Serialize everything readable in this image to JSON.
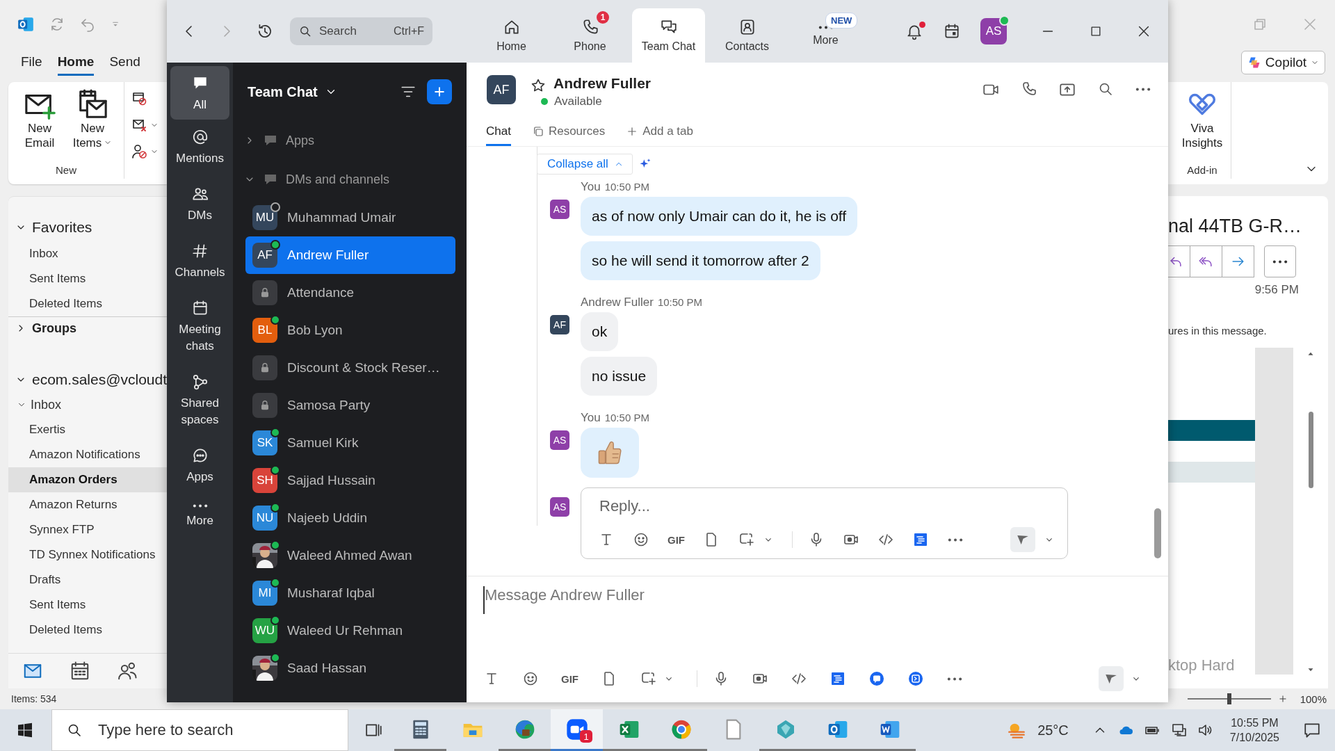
{
  "outlook": {
    "tabs": [
      {
        "label": "File",
        "selected": false
      },
      {
        "label": "Home",
        "selected": true
      },
      {
        "label": "Send",
        "selected": false
      }
    ],
    "ribbon": {
      "new_group": {
        "label": "New",
        "buttons": [
          {
            "label": "New Email",
            "kind": "new_email",
            "dropdown": false
          },
          {
            "label": "New Items",
            "kind": "new_items",
            "dropdown": true
          }
        ]
      },
      "addin_group": {
        "label": "Add-in",
        "buttons": [
          {
            "label": "Viva Insights"
          }
        ]
      },
      "copilot": "Copilot"
    },
    "nav": [
      {
        "label": "Favorites",
        "expanded": true,
        "bold": false,
        "children": [
          {
            "label": "Inbox",
            "selected": false
          },
          {
            "label": "Sent Items",
            "selected": false
          },
          {
            "label": "Deleted Items",
            "selected": false
          }
        ]
      },
      {
        "label": "Groups",
        "expanded": false,
        "bold": true
      },
      {
        "label": "ecom.sales@vcloudt",
        "expanded": true,
        "bold": false,
        "children": [
          {
            "label": "Inbox",
            "selected": false,
            "expanded": true,
            "children": [
              {
                "label": "Exertis",
                "selected": false
              },
              {
                "label": "Amazon Notifications",
                "selected": false
              },
              {
                "label": "Amazon Orders",
                "selected": true
              },
              {
                "label": "Amazon Returns",
                "selected": false
              },
              {
                "label": "Synnex FTP",
                "selected": false
              },
              {
                "label": "TD Synnex Notifications",
                "selected": false
              }
            ]
          },
          {
            "label": "Drafts",
            "selected": false
          },
          {
            "label": "Sent Items",
            "selected": false
          },
          {
            "label": "Deleted Items",
            "selected": false
          }
        ]
      }
    ],
    "status_bar": "Items: 534",
    "reading_pane": {
      "subject": "nal 44TB G-R…",
      "time": "9:56 PM",
      "notice": "ures in this message.",
      "body_text": "ktop Hard"
    },
    "zoom": {
      "level": 0.5,
      "reading": "100%"
    }
  },
  "zoom_app": {
    "search": {
      "placeholder": "Search",
      "shortcut": "Ctrl+F"
    },
    "nav_tabs": [
      {
        "label": "Home",
        "kind": "home",
        "selected": false
      },
      {
        "label": "Phone",
        "kind": "phone",
        "selected": false,
        "badge": "1"
      },
      {
        "label": "Team Chat",
        "kind": "chat",
        "selected": true
      },
      {
        "label": "Contacts",
        "kind": "contacts",
        "selected": false
      },
      {
        "label": "More",
        "kind": "more",
        "selected": false,
        "tag": "NEW"
      }
    ],
    "notifications_unread": true,
    "account": {
      "initials": "AS",
      "online": true
    },
    "rail": [
      {
        "label": "All",
        "kind": "all",
        "selected": true
      },
      {
        "label": "Mentions",
        "kind": "mentions",
        "selected": false
      },
      {
        "label": "DMs",
        "kind": "dms",
        "selected": false
      },
      {
        "label": "Channels",
        "kind": "channels",
        "selected": false
      },
      {
        "label": "Meeting chats",
        "kind": "meetings",
        "selected": false
      },
      {
        "label": "Shared spaces",
        "kind": "shared",
        "selected": false
      },
      {
        "label": "Apps",
        "kind": "apps",
        "selected": false
      },
      {
        "label": "More",
        "kind": "more",
        "selected": false
      }
    ],
    "list": {
      "title": "Team Chat",
      "sections": [
        {
          "label": "Apps",
          "expanded": false
        },
        {
          "label": "DMs and channels",
          "expanded": true,
          "children": [
            {
              "name": "Muhammad Umair",
              "kind": "person",
              "initials": "MU",
              "color": "#34465c",
              "online": false,
              "selected": false
            },
            {
              "name": "Andrew Fuller",
              "kind": "person",
              "initials": "AF",
              "color": "#34465c",
              "online": true,
              "selected": true
            },
            {
              "name": "Attendance",
              "kind": "channel",
              "selected": false
            },
            {
              "name": "Bob Lyon",
              "kind": "person",
              "initials": "BL",
              "color": "#e35e0e",
              "online": true,
              "selected": false
            },
            {
              "name": "Discount & Stock Reser…",
              "kind": "channel",
              "selected": false
            },
            {
              "name": "Samosa Party",
              "kind": "channel",
              "selected": false
            },
            {
              "name": "Samuel Kirk",
              "kind": "person",
              "initials": "SK",
              "color": "#2b88d8",
              "online": true,
              "selected": false
            },
            {
              "name": "Sajjad Hussain",
              "kind": "person",
              "initials": "SH",
              "color": "#d9443a",
              "online": true,
              "selected": false
            },
            {
              "name": "Najeeb Uddin",
              "kind": "person",
              "initials": "NU",
              "color": "#2b88d8",
              "online": true,
              "selected": false
            },
            {
              "name": "Waleed Ahmed Awan",
              "online": true,
              "selected": false
            },
            {
              "name": "Musharaf Iqbal",
              "kind": "person",
              "initials": "MI",
              "color": "#2b88d8",
              "online": true,
              "selected": false
            },
            {
              "name": "Waleed Ur Rehman",
              "kind": "person",
              "initials": "WU",
              "color": "#25a244",
              "online": true,
              "selected": false
            },
            {
              "name": "Saad Hassan",
              "online": true,
              "selected": false
            }
          ]
        }
      ]
    },
    "chat": {
      "contact": {
        "initials": "AF",
        "name": "Andrew Fuller",
        "status": "Available",
        "favorite": false
      },
      "tabs": [
        {
          "label": "Chat",
          "kind": "chat",
          "selected": true
        },
        {
          "label": "Resources",
          "kind": "resources",
          "selected": false
        },
        {
          "label": "Add a tab",
          "kind": "add",
          "selected": false
        }
      ],
      "thread": {
        "collapse_label": "Collapse all",
        "groups": [
          {
            "sender": "You",
            "time": "10:50 PM",
            "avatar": "AS",
            "mine": true,
            "messages": [
              {
                "kind": "text",
                "text": "as of now only Umair can do it, he is off"
              },
              {
                "kind": "text",
                "text": "so he will send it tomorrow after 2"
              }
            ]
          },
          {
            "sender": "Andrew Fuller",
            "time": "10:50 PM",
            "avatar": "AF",
            "mine": false,
            "messages": [
              {
                "kind": "text",
                "text": "ok"
              },
              {
                "kind": "text",
                "text": "no issue"
              }
            ]
          },
          {
            "sender": "You",
            "time": "10:50 PM",
            "avatar": "AS",
            "mine": true,
            "messages": [
              {
                "kind": "sticker"
              }
            ]
          }
        ]
      },
      "reply": {
        "avatar": "AS",
        "placeholder": "Reply...",
        "tools": [
          {
            "kind": "format"
          },
          {
            "kind": "emoji"
          },
          {
            "kind": "gif",
            "label": "GIF"
          },
          {
            "kind": "file"
          },
          {
            "kind": "screenshot"
          },
          {
            "kind": "dropdown"
          },
          {
            "kind": "mic"
          },
          {
            "kind": "video_clip"
          },
          {
            "kind": "code"
          },
          {
            "kind": "doc_app"
          },
          {
            "kind": "more"
          },
          {
            "kind": "send"
          },
          {
            "kind": "dropdown"
          }
        ]
      },
      "composer": {
        "placeholder": "Message Andrew Fuller",
        "tools": [
          {
            "kind": "format"
          },
          {
            "kind": "emoji"
          },
          {
            "kind": "gif",
            "label": "GIF"
          },
          {
            "kind": "file"
          },
          {
            "kind": "screenshot"
          },
          {
            "kind": "dropdown"
          },
          {
            "kind": "mic"
          },
          {
            "kind": "video_clip"
          },
          {
            "kind": "code"
          },
          {
            "kind": "doc_app"
          },
          {
            "kind": "chat_app"
          },
          {
            "kind": "panel_app"
          },
          {
            "kind": "more"
          },
          {
            "kind": "send"
          },
          {
            "kind": "dropdown"
          }
        ]
      }
    }
  },
  "taskbar": {
    "search_placeholder": "Type here to search",
    "apps": [
      {
        "kind": "calculator",
        "running": true,
        "active": false
      },
      {
        "kind": "explorer",
        "running": false,
        "active": false
      },
      {
        "kind": "edge",
        "running": true,
        "active": false
      },
      {
        "kind": "zoom",
        "running": true,
        "active": true,
        "badge": "1"
      },
      {
        "kind": "excel",
        "running": true,
        "active": false
      },
      {
        "kind": "chrome",
        "running": true,
        "active": false
      },
      {
        "kind": "file",
        "running": false,
        "active": false
      },
      {
        "kind": "teal_app",
        "running": true,
        "active": false
      },
      {
        "kind": "outlook",
        "running": true,
        "active": false
      },
      {
        "kind": "word",
        "running": true,
        "active": false
      }
    ],
    "weather": "25°C",
    "time": "10:55 PM",
    "date": "7/10/2025"
  }
}
